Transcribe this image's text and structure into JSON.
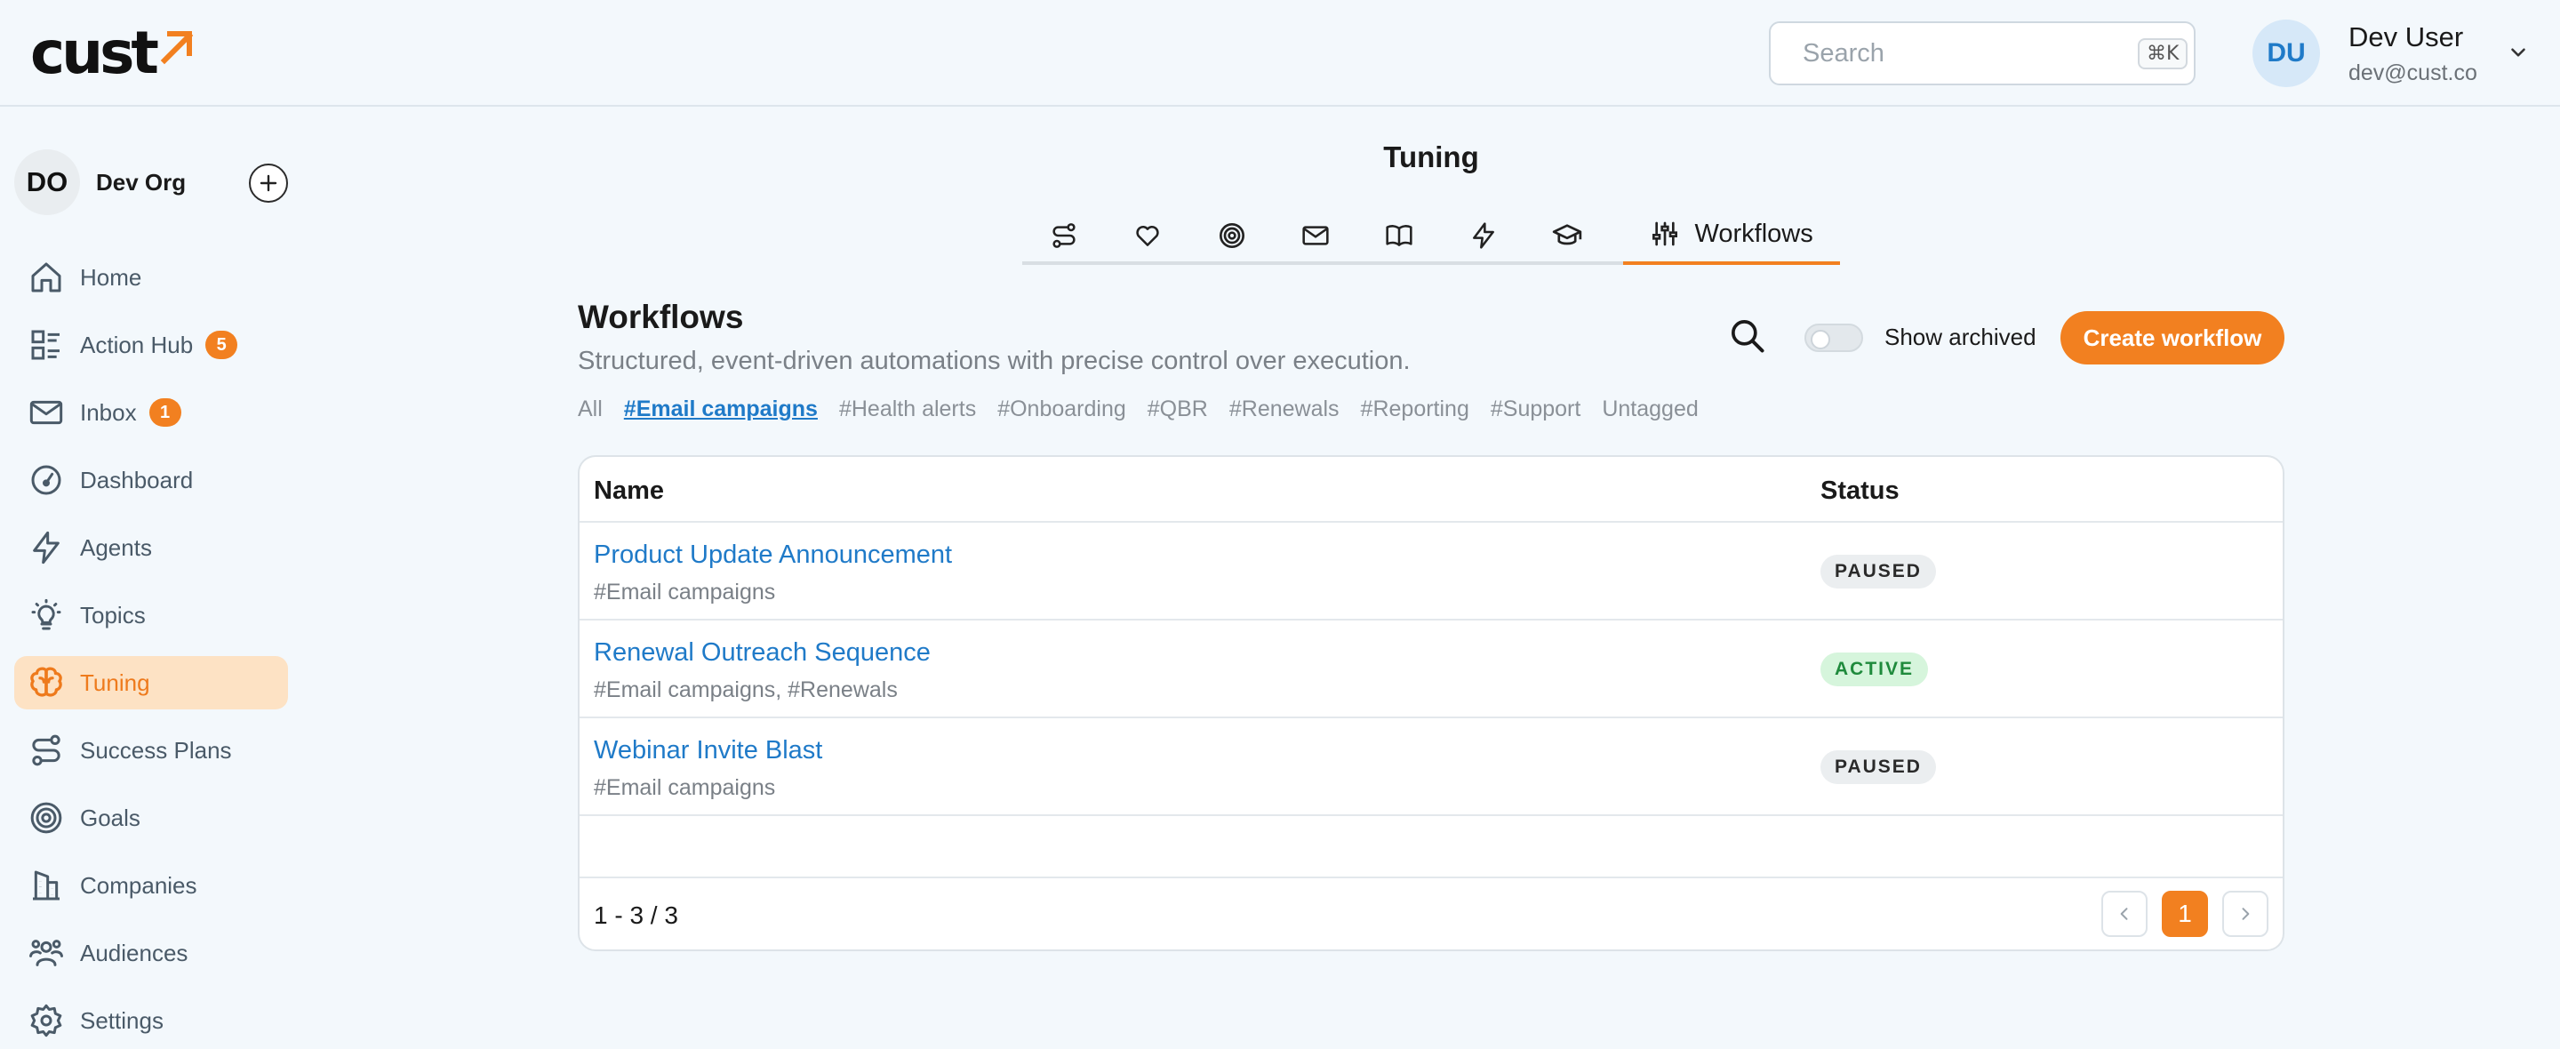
{
  "header": {
    "logo_text": "cust",
    "search": {
      "placeholder": "Search",
      "shortcut": "⌘K"
    },
    "user": {
      "initials": "DU",
      "name": "Dev User",
      "email": "dev@cust.co"
    }
  },
  "sidebar": {
    "org": {
      "initials": "DO",
      "name": "Dev Org"
    },
    "items": [
      {
        "label": "Home",
        "icon": "home-icon"
      },
      {
        "label": "Action Hub",
        "icon": "list-icon",
        "badge": "5"
      },
      {
        "label": "Inbox",
        "icon": "mail-icon",
        "badge": "1"
      },
      {
        "label": "Dashboard",
        "icon": "gauge-icon"
      },
      {
        "label": "Agents",
        "icon": "bolt-icon"
      },
      {
        "label": "Topics",
        "icon": "lightbulb-icon"
      },
      {
        "label": "Tuning",
        "icon": "brain-icon",
        "active": true
      },
      {
        "label": "Success Plans",
        "icon": "route-icon"
      },
      {
        "label": "Goals",
        "icon": "target-icon"
      },
      {
        "label": "Companies",
        "icon": "building-icon"
      },
      {
        "label": "Audiences",
        "icon": "users-icon"
      },
      {
        "label": "Settings",
        "icon": "gear-icon"
      }
    ]
  },
  "main": {
    "title": "Tuning",
    "tabs": [
      {
        "icon": "route-icon"
      },
      {
        "icon": "heart-icon"
      },
      {
        "icon": "target-icon"
      },
      {
        "icon": "mail-icon"
      },
      {
        "icon": "book-icon"
      },
      {
        "icon": "bolt-icon"
      },
      {
        "icon": "graduation-cap-icon"
      },
      {
        "icon": "sliders-icon",
        "label": "Workflows",
        "active": true
      }
    ],
    "section_title": "Workflows",
    "section_desc": "Structured, event-driven automations with precise control over execution.",
    "show_archived": "Show archived",
    "create_button": "Create workflow",
    "filters": [
      "All",
      "#Email campaigns",
      "#Health alerts",
      "#Onboarding",
      "#QBR",
      "#Renewals",
      "#Reporting",
      "#Support",
      "Untagged"
    ],
    "active_filter": "#Email campaigns",
    "table": {
      "columns": {
        "name": "Name",
        "status": "Status"
      },
      "rows": [
        {
          "name": "Product Update Announcement",
          "tags": "#Email campaigns",
          "status": "PAUSED"
        },
        {
          "name": "Renewal Outreach Sequence",
          "tags": "#Email campaigns, #Renewals",
          "status": "ACTIVE"
        },
        {
          "name": "Webinar Invite Blast",
          "tags": "#Email campaigns",
          "status": "PAUSED"
        }
      ],
      "range": "1 - 3 / 3",
      "current_page": "1"
    }
  },
  "colors": {
    "accent": "#f28020",
    "link": "#1f7ac8",
    "active_status": "#1f8a3c"
  }
}
